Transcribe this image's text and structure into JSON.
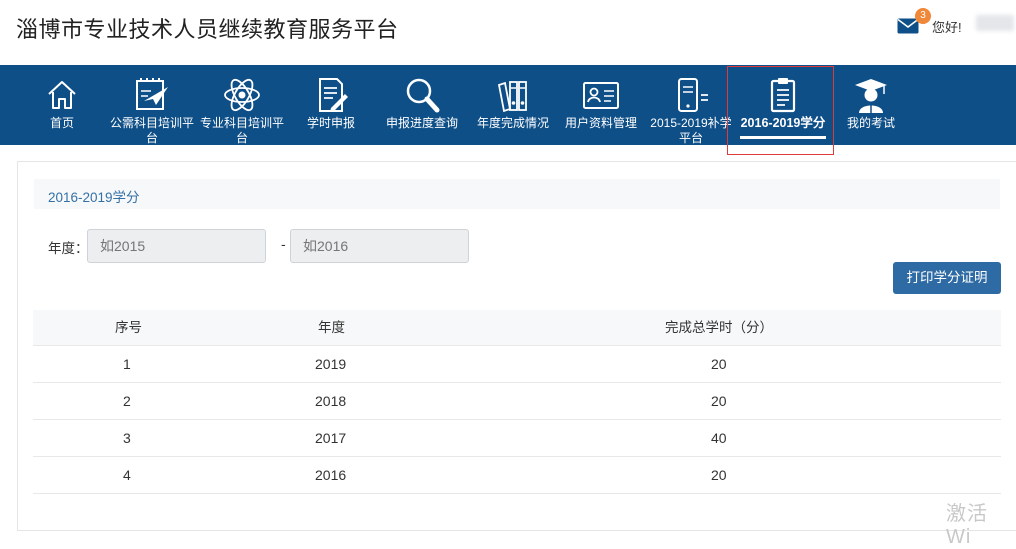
{
  "header": {
    "site_title": "淄博市专业技术人员继续教育服务平台",
    "mail_badge_count": "3",
    "greeting": "您好!",
    "mail_icon": "envelope-icon"
  },
  "nav": {
    "items": [
      {
        "label": "首页",
        "icon": "home-icon"
      },
      {
        "label": "公需科目培训平台",
        "icon": "paper-plane-board-icon"
      },
      {
        "label": "专业科目培训平台",
        "icon": "atom-icon"
      },
      {
        "label": "学时申报",
        "icon": "document-pen-icon"
      },
      {
        "label": "申报进度查询",
        "icon": "magnifier-icon"
      },
      {
        "label": "年度完成情况",
        "icon": "binders-icon"
      },
      {
        "label": "用户资料管理",
        "icon": "id-card-icon"
      },
      {
        "label": "2015-2019补学平台",
        "icon": "phone-list-icon"
      },
      {
        "label": "2016-2019学分",
        "icon": "clipboard-icon"
      },
      {
        "label": "我的考试",
        "icon": "graduate-icon"
      }
    ],
    "active_index": 8,
    "accent_color": "#0f4f88",
    "highlight_color": "#e03b3b"
  },
  "main": {
    "panel_title": "2016-2019学分",
    "year_label": "年度：",
    "year_from_placeholder": "如2015",
    "year_to_placeholder": "如2016",
    "separator": "-",
    "print_button": "打印学分证明",
    "table": {
      "columns": [
        "序号",
        "年度",
        "完成总学时（分）"
      ],
      "rows": [
        [
          "1",
          "2019",
          "20"
        ],
        [
          "2",
          "2018",
          "20"
        ],
        [
          "3",
          "2017",
          "40"
        ],
        [
          "4",
          "2016",
          "20"
        ]
      ]
    }
  },
  "watermark": "激活 Wi"
}
